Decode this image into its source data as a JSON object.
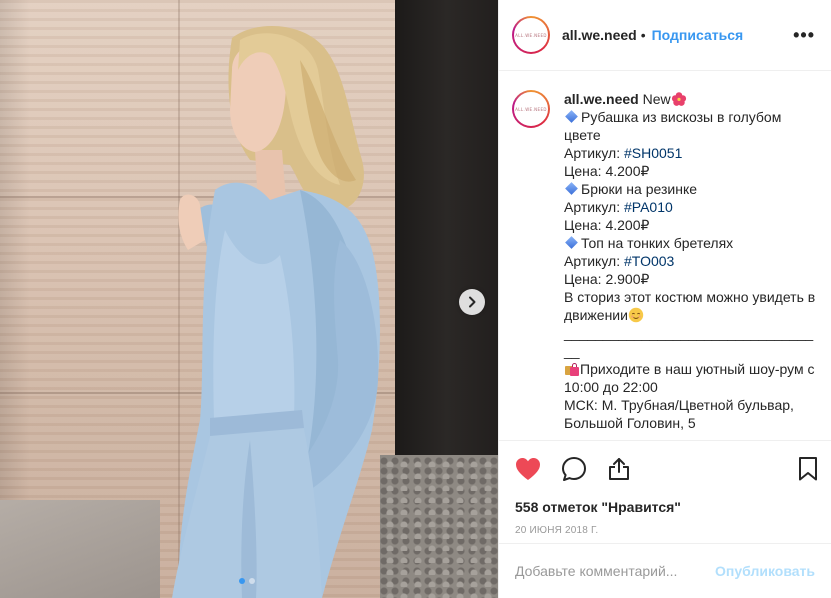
{
  "post": {
    "username": "all.we.need",
    "bullet": "•",
    "follow_label": "Подписаться",
    "more_label": "•••",
    "avatar_text": "ALL.WE.NEED",
    "caption": {
      "username": "all.we.need",
      "first_line": " New",
      "lines": [
        "Рубашка из вискозы в голубом цвете",
        "Артикул: ",
        "Цена: 4.200₽",
        "Брюки на резинке",
        "Артикул: ",
        "Цена: 4.200₽",
        "Топ на тонких бретелях",
        "Артикул: ",
        "Цена: 2.900₽",
        "В сториз этот костюм можно увидеть в движении",
        "__________________________________",
        "Приходите в наш уютный шоу-рум с 10:00 до 22:00",
        "МСК: М. Трубная/Цветной бульвар, Большой Головин, 5"
      ],
      "hashtags": [
        "#SH0051",
        "#PA010",
        "#TO003"
      ]
    },
    "likes": "558 отметок \"Нравится\"",
    "date": "20 июня 2018 г.",
    "comment_placeholder": "Добавьте комментарий...",
    "publish_label": "Опубликовать",
    "carousel": {
      "count": 2,
      "active": 1
    },
    "colors": {
      "accent": "#3897f0",
      "like": "#ed4956",
      "hashtag": "#003569",
      "publish_disabled": "#b2dffc"
    },
    "icons": [
      "chevron-right-icon",
      "heart-icon",
      "comment-icon",
      "share-icon",
      "bookmark-icon",
      "more-icon"
    ]
  }
}
